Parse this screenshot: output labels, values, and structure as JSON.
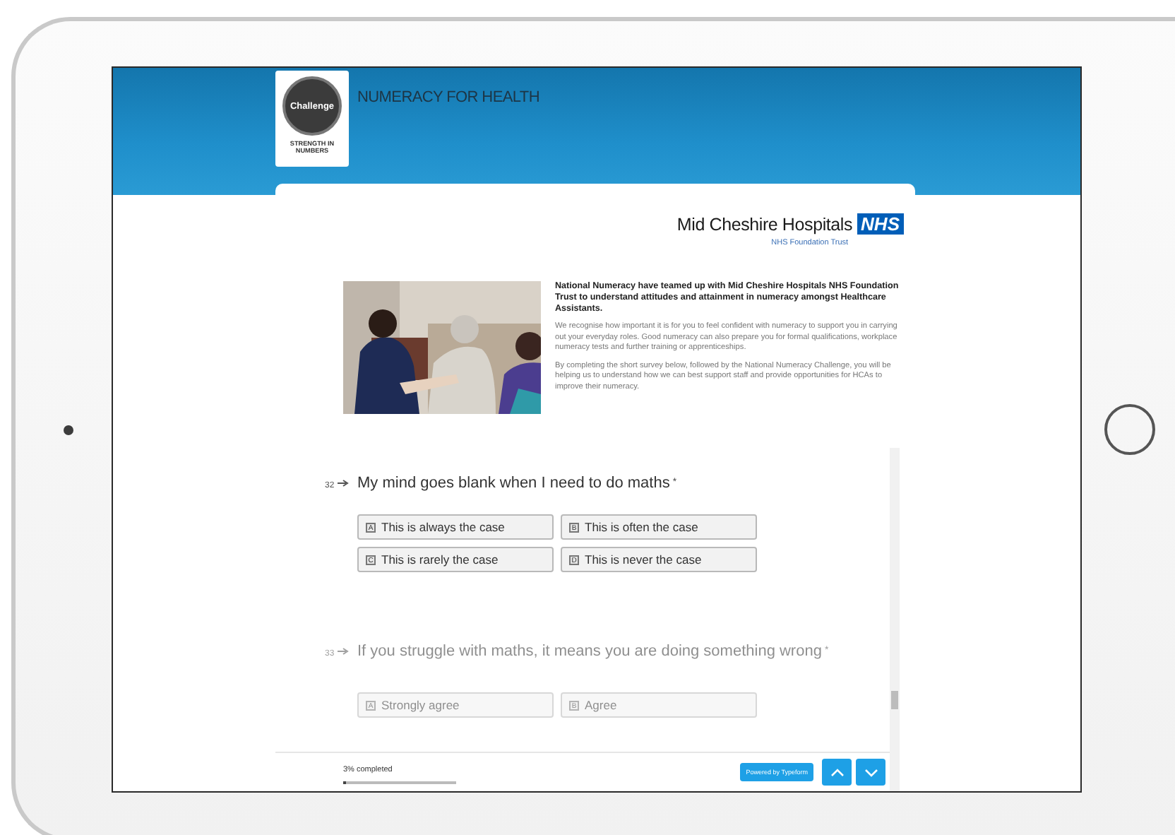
{
  "header": {
    "logo": {
      "badge": "Challenge",
      "tagline": "STRENGTH IN NUMBERS"
    },
    "title": "NUMERACY FOR HEALTH"
  },
  "partner": {
    "name": "Mid Cheshire Hospitals",
    "badge": "NHS",
    "subtitle": "NHS Foundation Trust"
  },
  "intro": {
    "lead": "National Numeracy have teamed up with Mid Cheshire Hospitals NHS Foundation Trust to understand attitudes and attainment in numeracy amongst Healthcare Assistants.",
    "paragraphs": [
      "We recognise how important it is for you to feel confident with numeracy to support you in carrying out your everyday roles. Good numeracy can also prepare you for formal qualifications, workplace numeracy tests and further training or apprenticeships.",
      "By completing the short survey below, followed by the National Numeracy Challenge, you will be helping us to understand how we can best support staff and provide opportunities for HCAs to improve their numeracy."
    ]
  },
  "questions": [
    {
      "number": "32",
      "text": "My mind goes blank when I need to do maths",
      "required_mark": "*",
      "active": true,
      "choices": [
        {
          "key": "A",
          "label": "This is always the case",
          "selected": false
        },
        {
          "key": "B",
          "label": "This is often the case",
          "selected": false
        },
        {
          "key": "C",
          "label": "This is rarely the case",
          "selected": false
        },
        {
          "key": "D",
          "label": "This is never the case",
          "selected": false
        }
      ]
    },
    {
      "number": "33",
      "text": "If you struggle with maths, it means you are doing something wrong",
      "required_mark": "*",
      "active": false,
      "choices": [
        {
          "key": "A",
          "label": "Strongly agree",
          "selected": false
        },
        {
          "key": "B",
          "label": "Agree",
          "selected": false
        }
      ]
    }
  ],
  "footer": {
    "progress_text": "3% completed",
    "level": 0.03,
    "powered_by": "Powered by Typeform",
    "nav": [
      {
        "kind": "up"
      },
      {
        "kind": "down"
      }
    ]
  }
}
